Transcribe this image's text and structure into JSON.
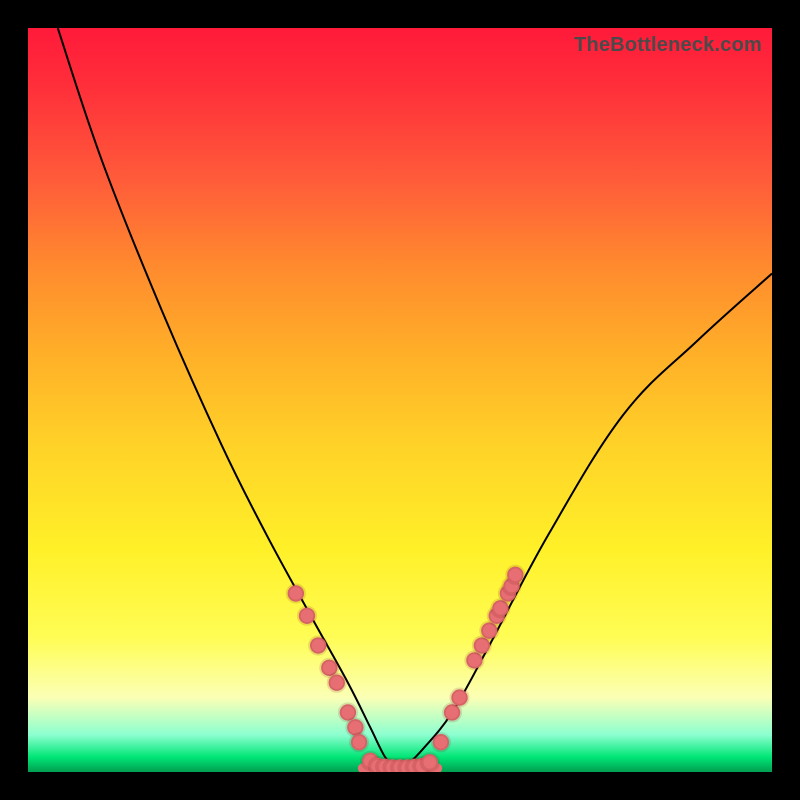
{
  "watermark": "TheBottleneck.com",
  "colors": {
    "dot_fill": "#e76f73",
    "curve_stroke": "#000000"
  },
  "chart_data": {
    "type": "line",
    "title": "",
    "xlabel": "",
    "ylabel": "",
    "xlim": [
      0,
      100
    ],
    "ylim": [
      0,
      100
    ],
    "grid": false,
    "legend": false,
    "series": [
      {
        "name": "left-curve",
        "x": [
          4,
          10,
          18,
          26,
          32,
          38,
          43,
          46,
          48,
          49.5
        ],
        "y": [
          100,
          82,
          62,
          44,
          32,
          21,
          12,
          6,
          2,
          0.5
        ]
      },
      {
        "name": "right-curve",
        "x": [
          50.5,
          53,
          57,
          62,
          70,
          80,
          90,
          100
        ],
        "y": [
          0.5,
          3,
          8,
          17,
          32,
          48,
          58,
          67
        ]
      },
      {
        "name": "floor-segment",
        "x": [
          45,
          55
        ],
        "y": [
          0.5,
          0.5
        ]
      }
    ],
    "points": [
      {
        "x": 36,
        "y": 24
      },
      {
        "x": 37.5,
        "y": 21
      },
      {
        "x": 39,
        "y": 17
      },
      {
        "x": 40.5,
        "y": 14
      },
      {
        "x": 41.5,
        "y": 12
      },
      {
        "x": 43,
        "y": 8
      },
      {
        "x": 44,
        "y": 6
      },
      {
        "x": 44.5,
        "y": 4
      },
      {
        "x": 46,
        "y": 1.5
      },
      {
        "x": 47,
        "y": 0.8
      },
      {
        "x": 48,
        "y": 0.7
      },
      {
        "x": 49,
        "y": 0.6
      },
      {
        "x": 50,
        "y": 0.6
      },
      {
        "x": 51,
        "y": 0.6
      },
      {
        "x": 52,
        "y": 0.7
      },
      {
        "x": 53,
        "y": 0.8
      },
      {
        "x": 54,
        "y": 1.3
      },
      {
        "x": 55.5,
        "y": 4
      },
      {
        "x": 57,
        "y": 8
      },
      {
        "x": 58,
        "y": 10
      },
      {
        "x": 60,
        "y": 15
      },
      {
        "x": 61,
        "y": 17
      },
      {
        "x": 62,
        "y": 19
      },
      {
        "x": 63,
        "y": 21
      },
      {
        "x": 63.5,
        "y": 22
      },
      {
        "x": 64.5,
        "y": 24
      },
      {
        "x": 65,
        "y": 25
      },
      {
        "x": 65.5,
        "y": 26.5
      }
    ],
    "point_radius": 1.1
  }
}
